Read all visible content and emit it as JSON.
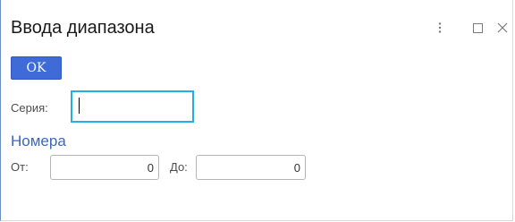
{
  "window": {
    "title": "Ввода диапазона",
    "controls": {
      "more_icon": "vertical-dots-icon",
      "maximize_icon": "maximize-square-icon",
      "close_icon": "close-x-icon"
    }
  },
  "toolbar": {
    "ok_label": "OK"
  },
  "form": {
    "series_label": "Серия:",
    "series_value": "",
    "numbers_group": {
      "title": "Номера",
      "from_label": "От:",
      "from_value": "0",
      "to_label": "До:",
      "to_value": "0"
    }
  },
  "colors": {
    "ok_button": "#3f6bd9",
    "focused_border": "#21b0e6",
    "group_title": "#3d68b7"
  }
}
